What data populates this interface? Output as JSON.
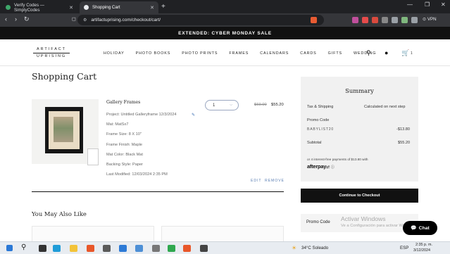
{
  "browser": {
    "tabs": [
      {
        "title": "Verify Codes — SimplyCodes"
      },
      {
        "title": "Shopping Cart"
      }
    ],
    "url": "artifactuprising.com/checkout/cart/",
    "vpn": "VPN"
  },
  "site": {
    "banner": "EXTENDED: CYBER MONDAY SALE",
    "logo_top": "ARTIFACT",
    "logo_bottom": "UPRISING",
    "menu": [
      "HOLIDAY",
      "PHOTO BOOKS",
      "PHOTO PRINTS",
      "FRAMES",
      "CALENDARS",
      "CARDS",
      "GIFTS",
      "WEDDING"
    ],
    "cart_count": "1"
  },
  "cart": {
    "title": "Shopping Cart",
    "item": {
      "name": "Gallery Frames",
      "project": "Project: Untitled Galleryframe 12/3/2024",
      "details": [
        "Mat: MatSx7",
        "Frame Size: 8 X 10\"",
        "Frame Finish: Maple",
        "Mat Color: Black Mat",
        "Backing Style: Paper",
        "Last Modified: 12/03/2024 2:35 PM"
      ],
      "quantity": "1",
      "old_price": "$69.00",
      "price": "$55.20",
      "edit": "EDIT",
      "remove": "REMOVE"
    },
    "also_like": "You May Also Like"
  },
  "summary": {
    "title": "Summary",
    "shipping_label": "Tax & Shipping",
    "shipping_value": "Calculated on next step",
    "promo_label": "Promo Code",
    "promo_code": "BABYLIST20",
    "discount": "-$13.80",
    "subtotal_label": "Subtotal",
    "subtotal": "$55.20",
    "afterpay_text": "or 4 interest-free payments of $13.80 with",
    "afterpay_brand": "afterpay",
    "checkout_label": "Continue to Checkout",
    "promo2_label": "Promo Code",
    "chat_label": "Chat"
  },
  "watermark": {
    "line1": "Activar Windows",
    "line2": "Ve a Configuración para activar Windows."
  },
  "taskbar": {
    "weather": "34°C  Soleado",
    "lang": "ESP",
    "time": "2:35 p. m.",
    "date": "3/12/2024"
  },
  "colors": {
    "banner": "#111111",
    "link": "#5b7fb4",
    "checkout": "#111111",
    "summary_bg": "#f1f1f1"
  }
}
